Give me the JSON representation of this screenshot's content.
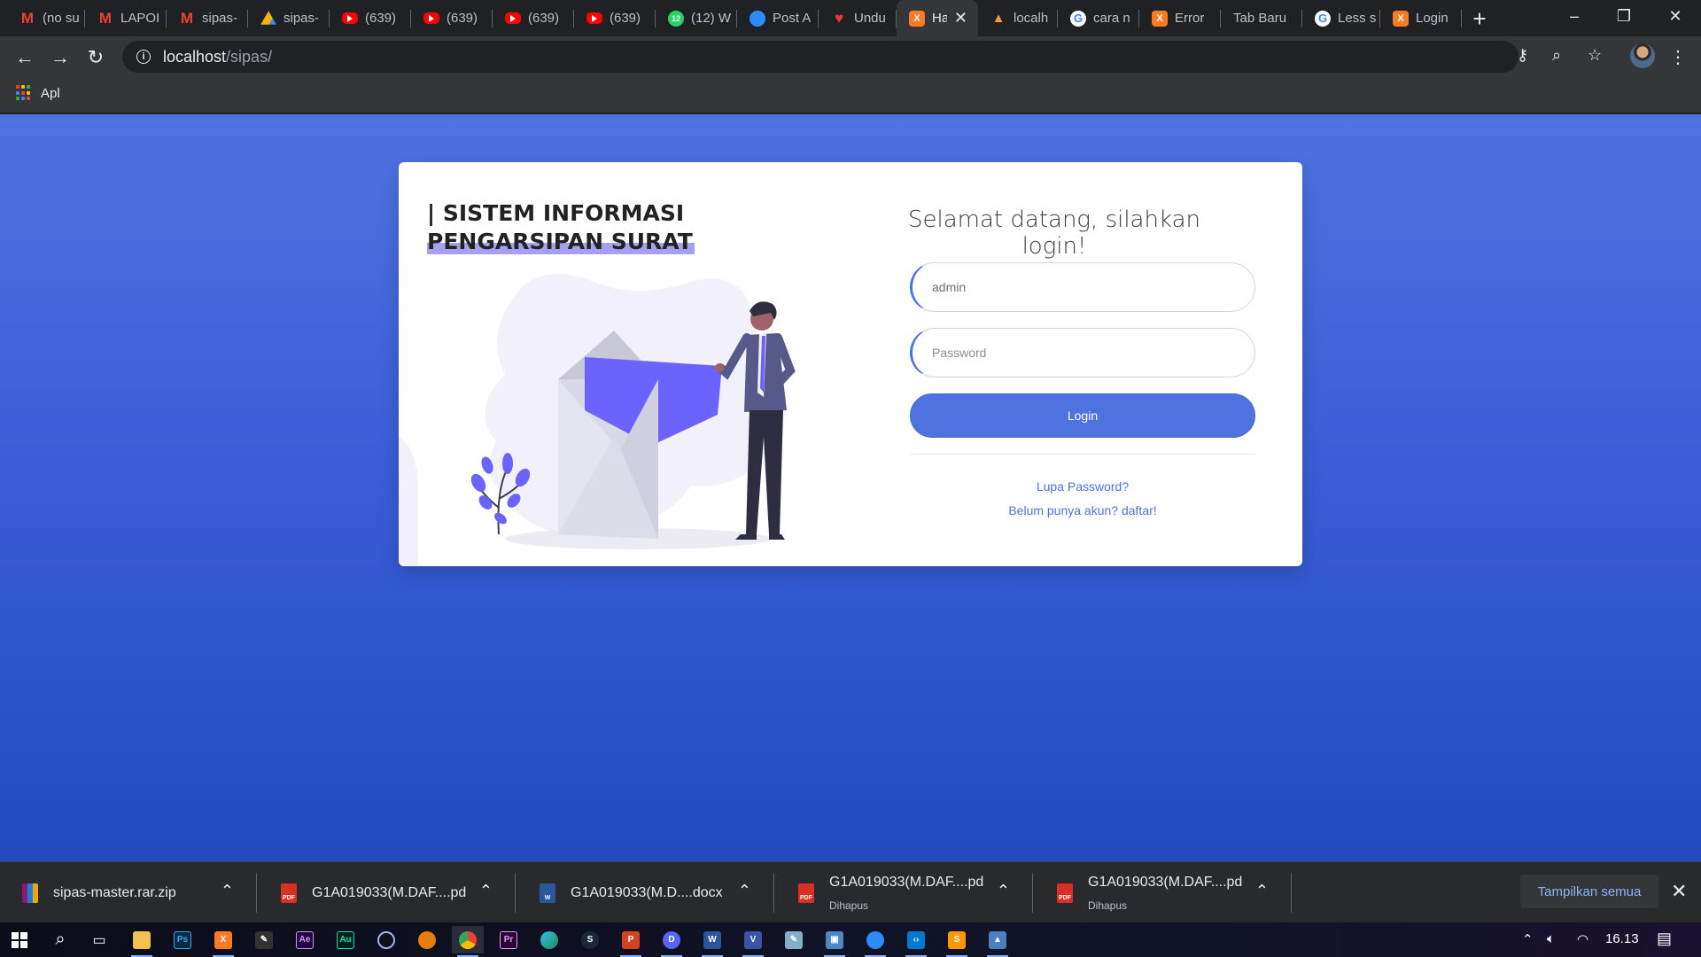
{
  "browser": {
    "tabs": [
      {
        "title": "(no su",
        "icon": "gmail-icon"
      },
      {
        "title": "LAPOI",
        "icon": "gmail-icon"
      },
      {
        "title": "sipas-",
        "icon": "gmail-icon"
      },
      {
        "title": "sipas-",
        "icon": "google-drive-icon"
      },
      {
        "title": "(639)",
        "icon": "youtube-icon"
      },
      {
        "title": "(639)",
        "icon": "youtube-icon"
      },
      {
        "title": "(639)",
        "icon": "youtube-icon"
      },
      {
        "title": "(639)",
        "icon": "youtube-icon"
      },
      {
        "title": "(12) W",
        "icon": "whatsapp-icon",
        "badge": "12"
      },
      {
        "title": "Post A",
        "icon": "zoom-icon"
      },
      {
        "title": "Undu",
        "icon": "heart-icon"
      },
      {
        "title": "Ha",
        "icon": "xampp-icon",
        "active": true
      },
      {
        "title": "localh",
        "icon": "lamp-icon"
      },
      {
        "title": "cara n",
        "icon": "google-icon"
      },
      {
        "title": "Error",
        "icon": "xampp-icon"
      },
      {
        "title": "Tab Baru",
        "icon": ""
      },
      {
        "title": "Less s",
        "icon": "google-icon"
      },
      {
        "title": "Login",
        "icon": "xampp-icon"
      }
    ],
    "address": {
      "host": "localhost",
      "path": "/sipas/"
    },
    "bookmarks": {
      "apps_label": "Apl"
    }
  },
  "page": {
    "brand_line1": "| SISTEM INFORMASI",
    "brand_line2": "PENGARSIPAN SURAT",
    "welcome": "Selamat datang, silahkan login!",
    "username_value": "admin",
    "password_placeholder": "Password",
    "login_label": "Login",
    "forgot_link": "Lupa Password?",
    "register_link": "Belum punya akun? daftar!"
  },
  "downloads": {
    "items": [
      {
        "name": "sipas-master.rar.zip",
        "status": "",
        "icon": "winrar-icon"
      },
      {
        "name": "G1A019033(M.DAF....pd",
        "status": "",
        "icon": "pdf-icon"
      },
      {
        "name": "G1A019033(M.D....docx",
        "status": "",
        "icon": "word-doc-icon"
      },
      {
        "name": "G1A019033(M.DAF....pd",
        "status": "Dihapus",
        "icon": "pdf-icon"
      },
      {
        "name": "G1A019033(M.DAF....pd",
        "status": "Dihapus",
        "icon": "pdf-icon"
      }
    ],
    "show_all": "Tampilkan semua"
  },
  "taskbar": {
    "clock": "16.13"
  },
  "colors": {
    "primary": "#4e73df",
    "gradient_end": "#224abe",
    "illustration_accent": "#6c63ff",
    "highlight": "#a6a0f2"
  }
}
